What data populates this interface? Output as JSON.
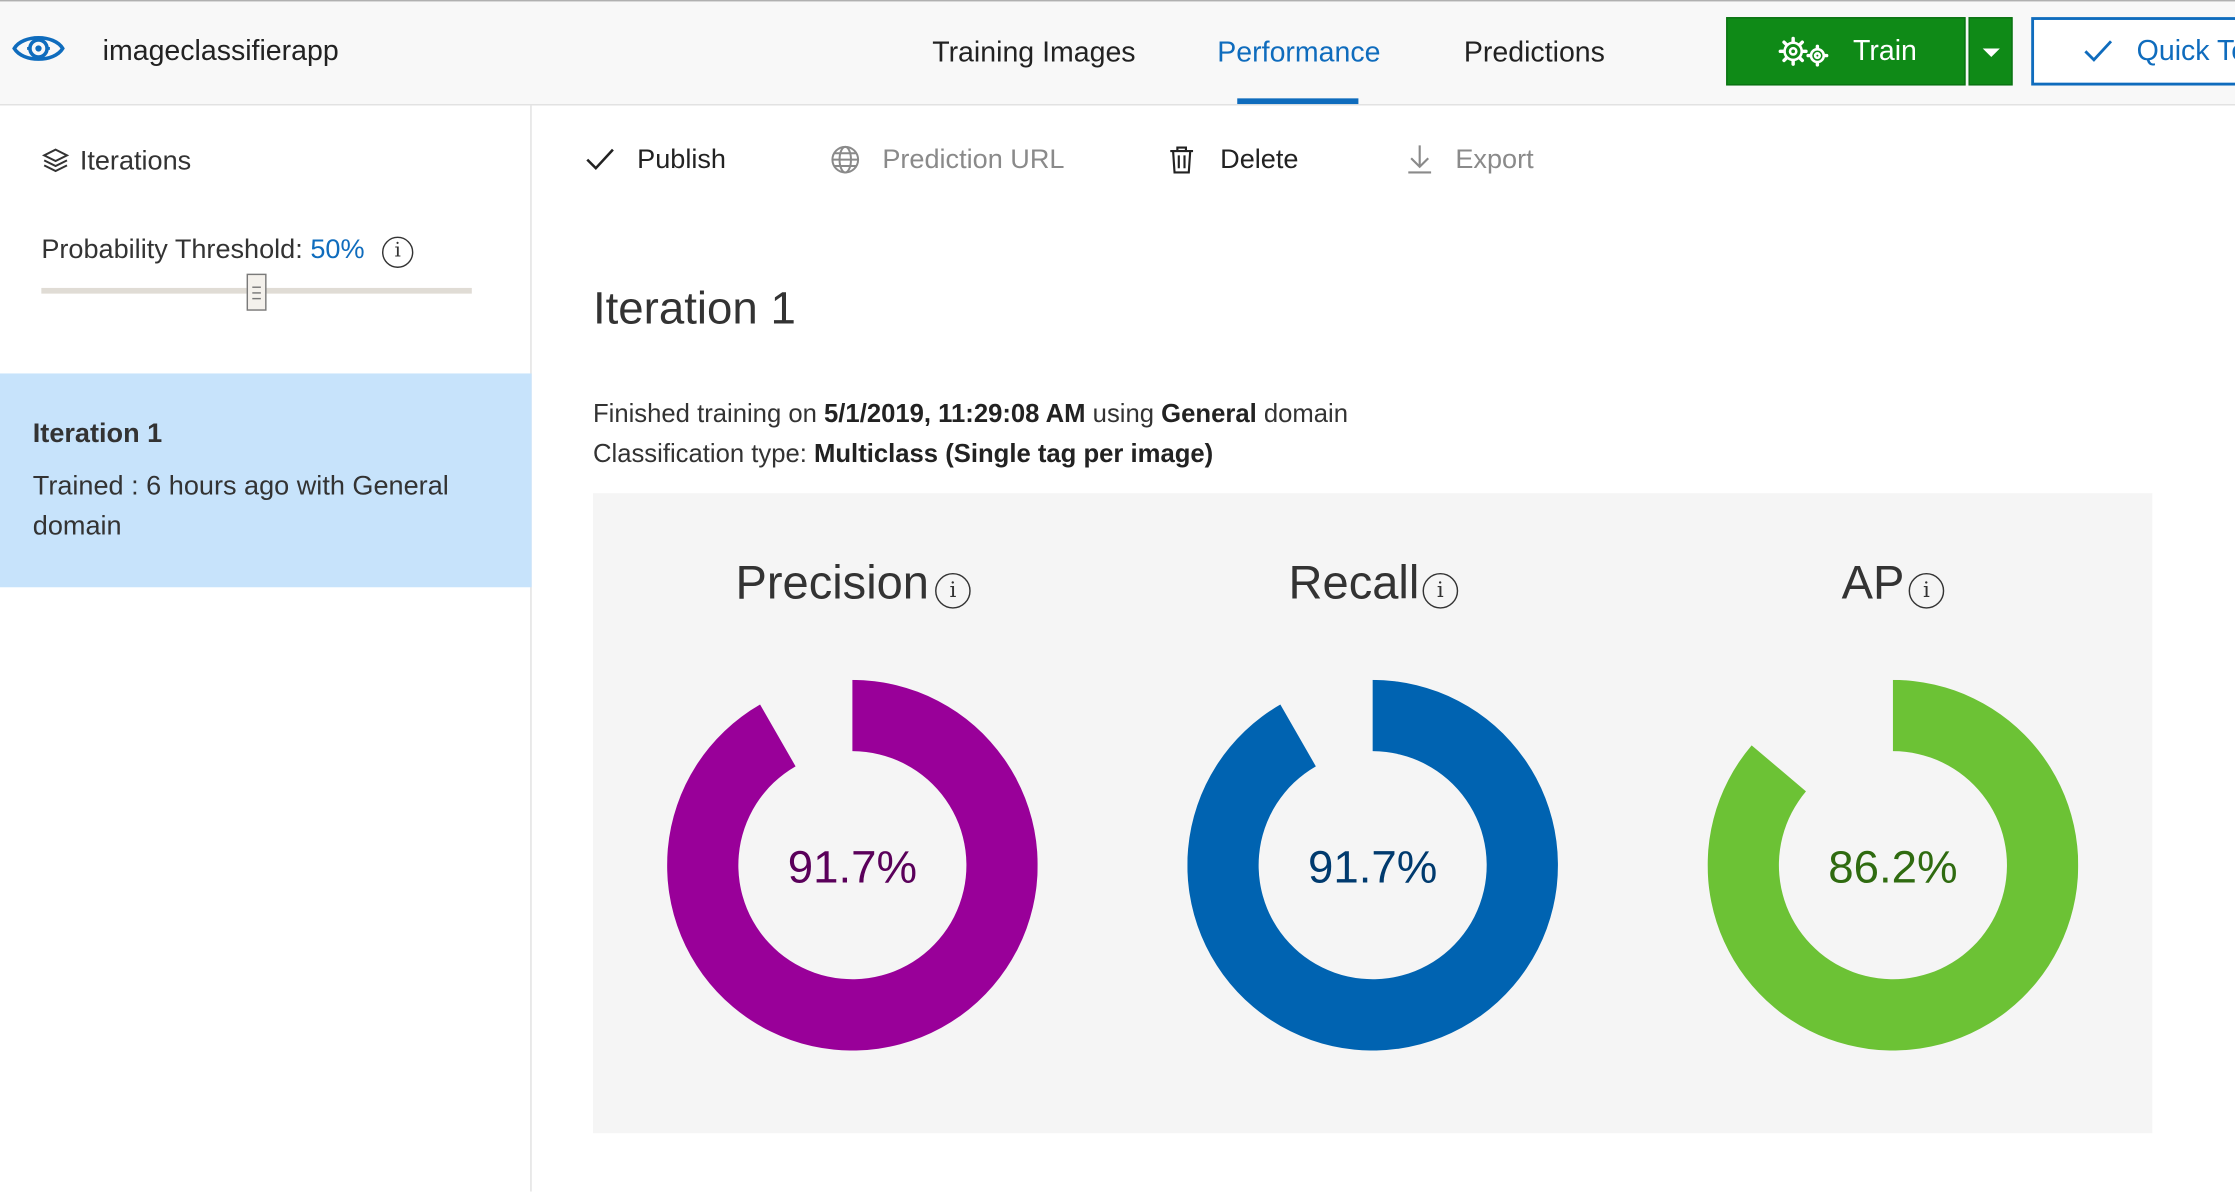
{
  "header": {
    "app_name": "imageclassifierapp",
    "tabs": [
      {
        "label": "Training Images",
        "active": false
      },
      {
        "label": "Performance",
        "active": true
      },
      {
        "label": "Predictions",
        "active": false
      }
    ],
    "train_label": "Train",
    "quick_test_label": "Quick Te",
    "logo_icon": "eye-gear-icon",
    "accent_color": "#0f6cbd",
    "train_color": "#0f8a17"
  },
  "sidebar": {
    "iterations_label": "Iterations",
    "threshold_label": "Probability Threshold:",
    "threshold_value": "50%",
    "threshold_fraction": 0.5,
    "info_glyph": "i",
    "iterations": [
      {
        "title": "Iteration 1",
        "description": "Trained : 6 hours ago with General domain",
        "selected": true
      }
    ]
  },
  "commands": [
    {
      "label": "Publish",
      "icon": "check-icon",
      "enabled": true
    },
    {
      "label": "Prediction URL",
      "icon": "globe-icon",
      "enabled": false
    },
    {
      "label": "Delete",
      "icon": "trash-icon",
      "enabled": true
    },
    {
      "label": "Export",
      "icon": "download-icon",
      "enabled": false
    }
  ],
  "main": {
    "title": "Iteration 1",
    "finished_prefix": "Finished training on ",
    "finished_date": "5/1/2019, 11:29:08 AM",
    "finished_using": " using ",
    "domain": "General",
    "domain_suffix": " domain",
    "classification_prefix": "Classification type: ",
    "classification_type": "Multiclass (Single tag per image)"
  },
  "metrics": [
    {
      "name": "Precision",
      "value_text": "91.7%",
      "value": 0.917,
      "color": "#990099",
      "text_color": "#5a005a"
    },
    {
      "name": "Recall",
      "value_text": "91.7%",
      "value": 0.917,
      "color": "#0063b1",
      "text_color": "#003a6e"
    },
    {
      "name": "AP",
      "value_text": "86.2%",
      "value": 0.862,
      "color": "#6cc235",
      "text_color": "#2f6b10"
    }
  ]
}
